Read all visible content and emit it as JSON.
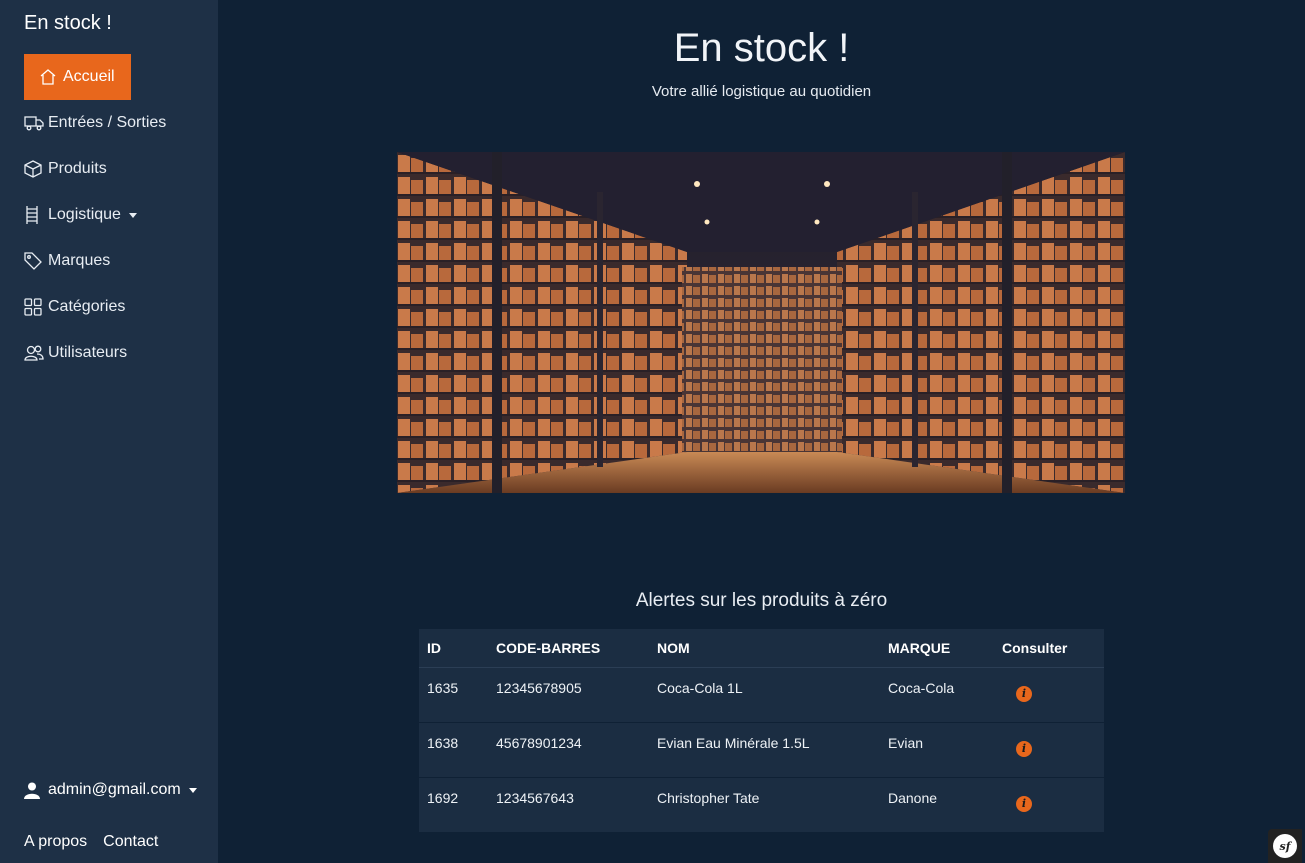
{
  "sidebar": {
    "brand": "En stock !",
    "items": [
      {
        "label": "Accueil",
        "icon": "home-icon"
      },
      {
        "label": "Entrées / Sorties",
        "icon": "truck-icon"
      },
      {
        "label": "Produits",
        "icon": "box-icon"
      },
      {
        "label": "Logistique",
        "icon": "ladder-icon"
      },
      {
        "label": "Marques",
        "icon": "tag-icon"
      },
      {
        "label": "Catégories",
        "icon": "grid-icon"
      },
      {
        "label": "Utilisateurs",
        "icon": "users-icon"
      }
    ],
    "user_email": "admin@gmail.com",
    "footer": {
      "about": "A propos",
      "contact": "Contact"
    }
  },
  "main": {
    "title": "En stock !",
    "subtitle": "Votre allié logistique au quotidien",
    "alerts_title": "Alertes sur les produits à zéro",
    "table": {
      "headers": [
        "ID",
        "CODE-BARRES",
        "NOM",
        "MARQUE",
        "Consulter"
      ],
      "rows": [
        {
          "id": "1635",
          "barcode": "12345678905",
          "name": "Coca-Cola 1L",
          "brand": "Coca-Cola"
        },
        {
          "id": "1638",
          "barcode": "45678901234",
          "name": "Evian Eau Minérale 1.5L",
          "brand": "Evian"
        },
        {
          "id": "1692",
          "barcode": "1234567643",
          "name": "Christopher Tate",
          "brand": "Danone"
        }
      ]
    }
  },
  "colors": {
    "accent": "#e8671c",
    "sidebar_bg": "#1e3046",
    "page_bg": "#0f2135",
    "table_bg": "#1b2d42"
  }
}
